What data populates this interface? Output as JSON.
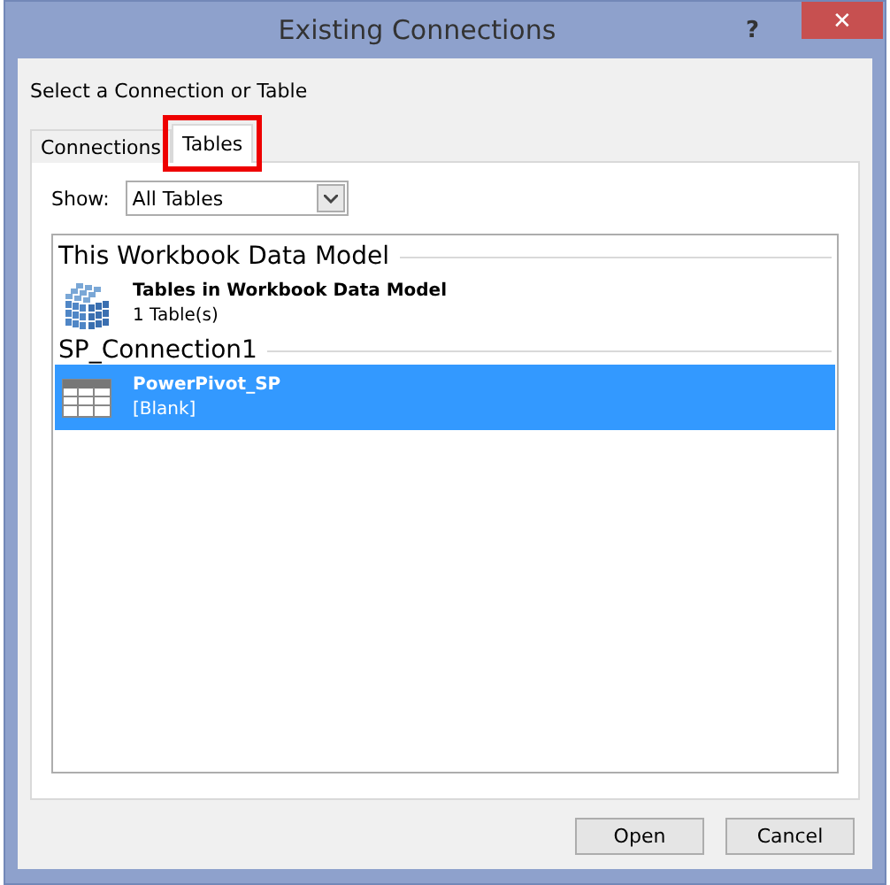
{
  "window": {
    "title": "Existing Connections",
    "help": "?",
    "close": "✕"
  },
  "heading": "Select a Connection or Table",
  "tabs": [
    {
      "label": "Connections",
      "selected": false,
      "highlighted": false
    },
    {
      "label": "Tables",
      "selected": true,
      "highlighted": true
    }
  ],
  "show": {
    "label": "Show:",
    "value": "All Tables"
  },
  "groups": [
    {
      "title": "This Workbook Data Model",
      "items": [
        {
          "kind": "model",
          "name": "Tables in Workbook Data Model",
          "detail": "1 Table(s)",
          "selected": false
        }
      ]
    },
    {
      "title": "SP_Connection1",
      "items": [
        {
          "kind": "table",
          "name": "PowerPivot_SP",
          "detail": "[Blank]",
          "selected": true
        }
      ]
    }
  ],
  "buttons": [
    "Open",
    "Cancel"
  ]
}
